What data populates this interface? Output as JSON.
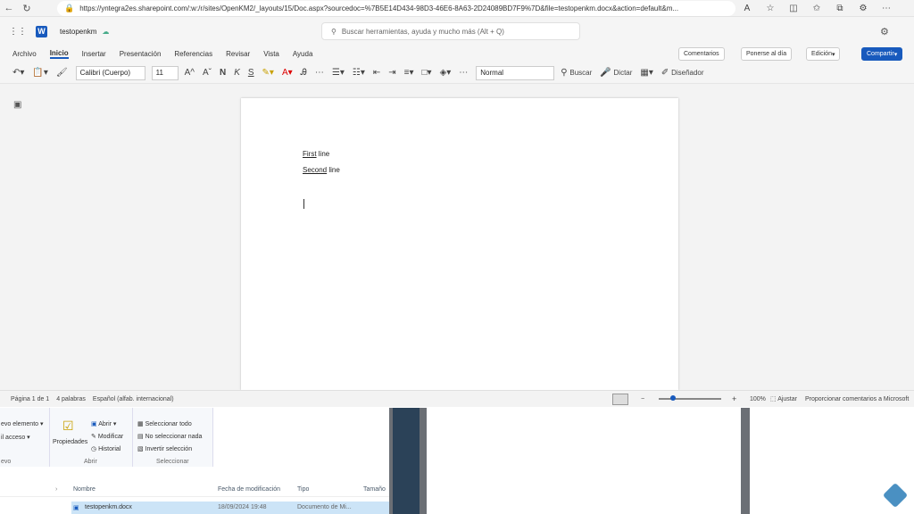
{
  "browser": {
    "url": "https://yntegra2es.sharepoint.com/:w:/r/sites/OpenKM2/_layouts/15/Doc.aspx?sourcedoc=%7B5E14D434-98D3-46E6-8A63-2D24089BD7F9%7D&file=testopenkm.docx&action=default&m..."
  },
  "word": {
    "file_name": "testopenkm",
    "search_placeholder": "Buscar herramientas, ayuda y mucho más (Alt + Q)",
    "tabs": [
      "Archivo",
      "Inicio",
      "Insertar",
      "Presentación",
      "Referencias",
      "Revisar",
      "Vista",
      "Ayuda"
    ],
    "comments": "Comentarios",
    "catch_up": "Ponerse al día",
    "editing": "Edición",
    "share": "Compartir",
    "font": "Calibri (Cuerpo)",
    "size": "11",
    "style": "Normal",
    "find": "Buscar",
    "dictate": "Dictar",
    "designer": "Diseñador"
  },
  "document": {
    "line1_word": "First",
    "line1_rest": " line",
    "line2_word": "Second",
    "line2_rest": " line"
  },
  "status": {
    "page": "Página 1 de 1",
    "words": "4 palabras",
    "lang": "Español (alfab. internacional)",
    "zoom": "100%",
    "fit": "Ajustar",
    "feedback": "Proporcionar comentarios a Microsoft"
  },
  "explorer": {
    "new_item": "evo elemento ▾",
    "easy_access": "il acceso ▾",
    "left_group": "evo",
    "properties": "Propiedades",
    "open": "Abrir ▾",
    "modify": "Modificar",
    "history": "Historial",
    "open_group": "Abrir",
    "select_all": "Seleccionar todo",
    "select_none": "No seleccionar nada",
    "invert": "Invertir selección",
    "select_group": "Seleccionar",
    "col_name": "Nombre",
    "col_date": "Fecha de modificación",
    "col_type": "Tipo",
    "col_size": "Tamaño",
    "file_name": "testopenkm.docx",
    "file_date": "18/09/2024 19:48",
    "file_type": "Documento de Mi..."
  }
}
